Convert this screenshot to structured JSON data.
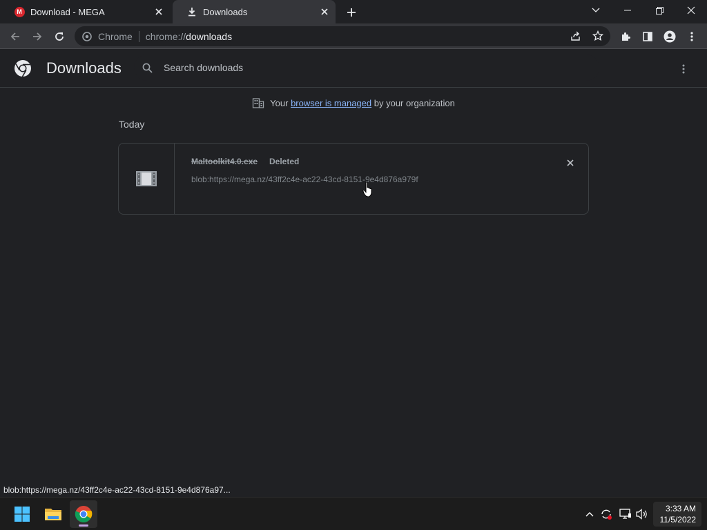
{
  "tabs": [
    {
      "title": "Download - MEGA",
      "favicon": "mega-logo-icon",
      "favicon_text": "M",
      "active": false
    },
    {
      "title": "Downloads",
      "favicon": "download-icon",
      "active": true
    }
  ],
  "omnibox": {
    "chip": "Chrome",
    "url_scheme": "chrome://",
    "url_host": "downloads"
  },
  "page": {
    "title": "Downloads",
    "search_placeholder": "Search downloads",
    "managed_prefix": "Your",
    "managed_link": "browser is managed",
    "managed_suffix": "by your organization",
    "section_date": "Today"
  },
  "download": {
    "filename": "Maltoolkit4.0.exe",
    "status": "Deleted",
    "url": "blob:https://mega.nz/43ff2c4e-ac22-43cd-8151-9e4d876a979f"
  },
  "status_bar": "blob:https://mega.nz/43ff2c4e-ac22-43cd-8151-9e4d876a97...",
  "taskbar": {
    "time": "3:33 AM",
    "date": "11/5/2022"
  },
  "colors": {
    "accent": "#8ab4f8",
    "background": "#202124",
    "toolbar": "#35363a"
  }
}
